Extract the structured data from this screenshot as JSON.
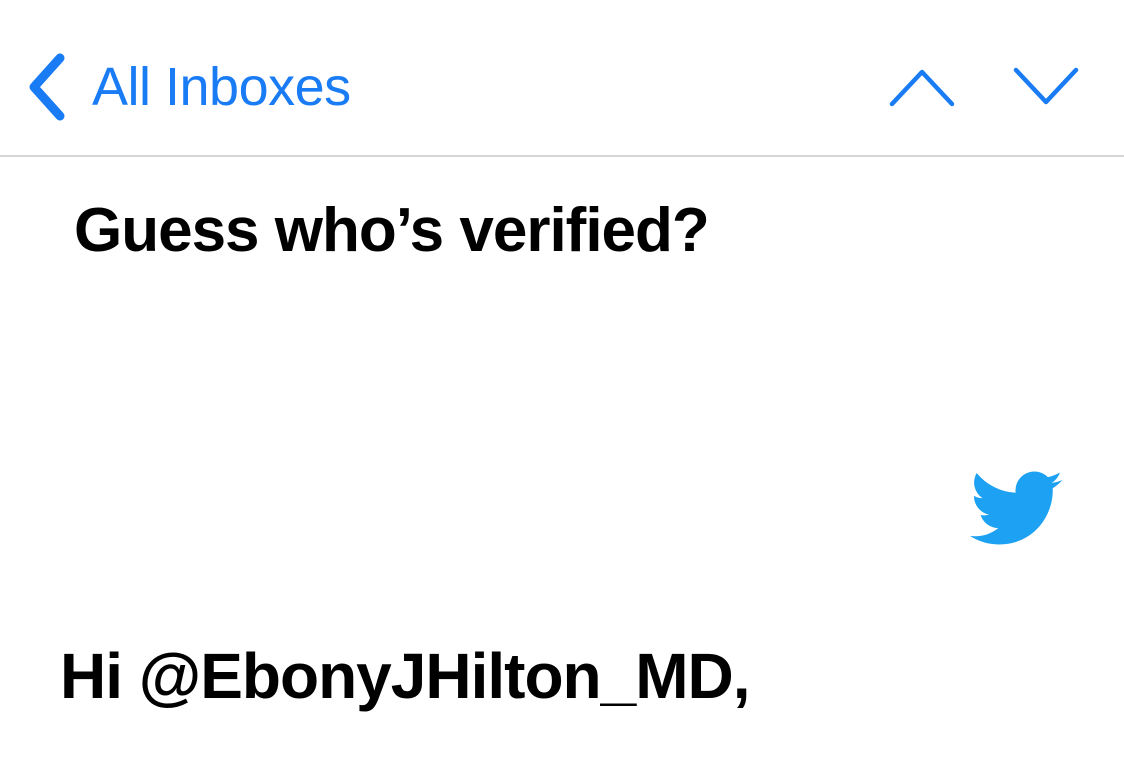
{
  "nav": {
    "back_label": "All Inboxes",
    "back_icon": "chevron-left-icon",
    "prev_icon": "chevron-up-icon",
    "next_icon": "chevron-down-icon",
    "accent_color": "#1A7CF5"
  },
  "email": {
    "headline": "Guess who’s verified?",
    "logo_icon": "twitter-bird-icon",
    "logo_color": "#1DA1F2",
    "greeting": "Hi @EbonyJHilton_MD,"
  }
}
